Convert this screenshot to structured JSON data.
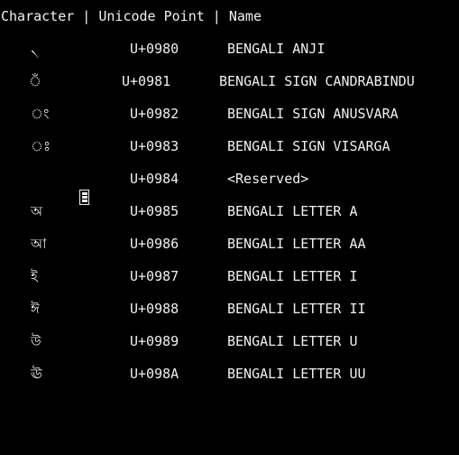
{
  "header": "Character | Unicode Point | Name",
  "rows": [
    {
      "char": "৲",
      "code": "U+0980",
      "name": "BENGALI ANJI"
    },
    {
      "char": "ঁ",
      "code": "U+0981",
      "name": "BENGALI SIGN CANDRABINDU"
    },
    {
      "char": "ং",
      "code": "U+0982",
      "name": "BENGALI SIGN ANUSVARA"
    },
    {
      "char": "ঃ",
      "code": "U+0983",
      "name": "BENGALI SIGN VISARGA"
    },
    {
      "char": "",
      "code": "U+0984",
      "name": "<Reserved>"
    },
    {
      "char": "অ",
      "code": "U+0985",
      "name": "BENGALI LETTER A"
    },
    {
      "char": "আ",
      "code": "U+0986",
      "name": "BENGALI LETTER AA"
    },
    {
      "char": "ই",
      "code": "U+0987",
      "name": "BENGALI LETTER I"
    },
    {
      "char": "ঈ",
      "code": "U+0988",
      "name": "BENGALI LETTER II"
    },
    {
      "char": "উ",
      "code": "U+0989",
      "name": "BENGALI LETTER U"
    },
    {
      "char": "ঊ",
      "code": "U+098A",
      "name": "BENGALI LETTER UU"
    }
  ]
}
